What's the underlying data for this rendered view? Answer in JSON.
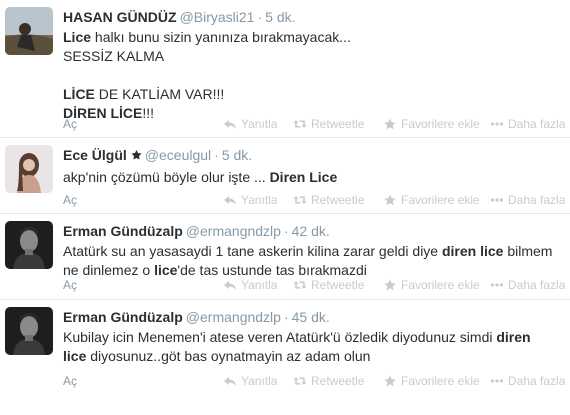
{
  "tweets": [
    {
      "fullname": "HASAN GÜNDÜZ",
      "username": "@Biryasli21",
      "time": "5 dk.",
      "text_lines": [
        [
          {
            "t": "Lice",
            "b": true
          },
          {
            "t": " halkı bunu sizin yanınıza bırakmayacak...",
            "b": false
          }
        ],
        [
          {
            "t": " SESSİZ KALMA",
            "b": false
          }
        ],
        [],
        [
          {
            "t": "LİCE",
            "b": true
          },
          {
            "t": " DE KATLİAM VAR!!!",
            "b": false
          }
        ],
        [
          {
            "t": "DİREN LİCE",
            "b": true
          },
          {
            "t": "!!!",
            "b": false
          }
        ]
      ]
    },
    {
      "fullname": "Ece Ülgül",
      "username": "@eceulgul",
      "time": "5 dk.",
      "verified_badge": true,
      "text_lines": [
        [
          {
            "t": "akp'nin çözümü böyle olur işte ... ",
            "b": false
          },
          {
            "t": "Diren Lice",
            "b": true
          }
        ]
      ]
    },
    {
      "fullname": "Erman Gündüzalp",
      "username": "@ermangndzlp",
      "time": "42 dk.",
      "text_lines": [
        [
          {
            "t": "Atatürk su an yasasaydi 1 tane askerin kilina zarar geldi diye ",
            "b": false
          },
          {
            "t": "diren lice",
            "b": true
          },
          {
            "t": " bilmem",
            "b": false
          }
        ],
        [
          {
            "t": "ne dinlemez o ",
            "b": false
          },
          {
            "t": "lice",
            "b": true
          },
          {
            "t": "'de tas ustunde tas bırakmazdi",
            "b": false
          }
        ]
      ]
    },
    {
      "fullname": "Erman Gündüzalp",
      "username": "@ermangndzlp",
      "time": "45 dk.",
      "text_lines": [
        [
          {
            "t": "Kubilay icin Menemen'i atese veren Atatürk'ü özledik diyodunuz simdi ",
            "b": false
          },
          {
            "t": "diren",
            "b": true
          }
        ],
        [
          {
            "t": "lice",
            "b": true
          },
          {
            "t": " diyosunuz..göt bas oynatmayin az adam olun",
            "b": false
          }
        ]
      ]
    }
  ],
  "actions": {
    "expand": "Aç",
    "reply": "Yanıtla",
    "retweet": "Retweetle",
    "favorite": "Favorilere ekle",
    "more": "Daha fazla"
  },
  "colors": {
    "name": "#292f33",
    "muted": "#8899a6",
    "action": "#c4ccd2",
    "divider": "#e1e8ed"
  }
}
